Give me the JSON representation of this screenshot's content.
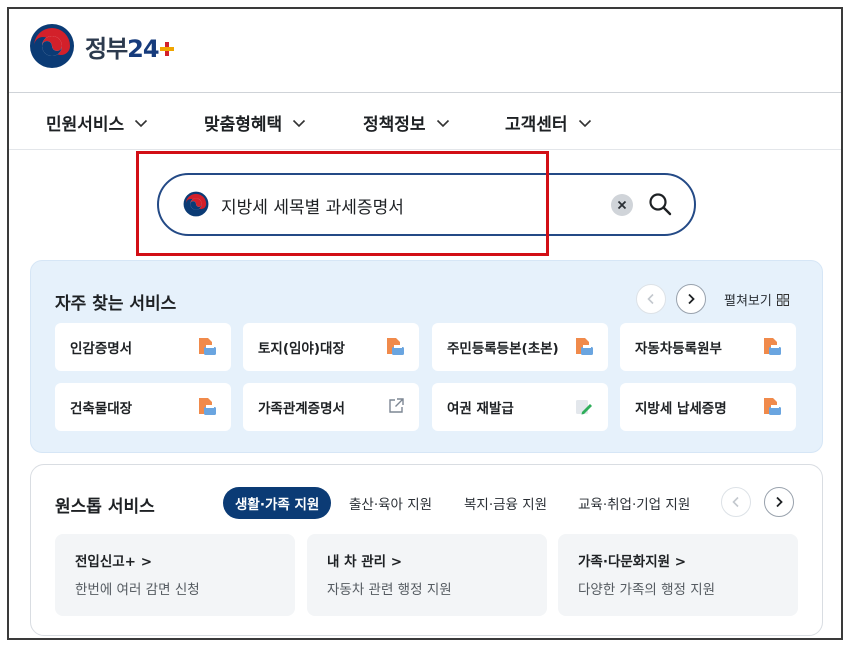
{
  "logo": {
    "text": "정부",
    "number": "24"
  },
  "nav": [
    {
      "label": "민원서비스"
    },
    {
      "label": "맞춤형혜택"
    },
    {
      "label": "정책정보"
    },
    {
      "label": "고객센터"
    }
  ],
  "search": {
    "value": "지방세 세목별 과세증명서"
  },
  "frequent": {
    "title": "자주 찾는 서비스",
    "expand_label": "펼쳐보기",
    "items": [
      {
        "label": "인감증명서",
        "icon": "document-print-icon"
      },
      {
        "label": "토지(임야)대장",
        "icon": "document-print-icon"
      },
      {
        "label": "주민등록등본(초본)",
        "icon": "document-print-icon"
      },
      {
        "label": "자동차등록원부",
        "icon": "document-print-icon"
      },
      {
        "label": "건축물대장",
        "icon": "document-print-icon"
      },
      {
        "label": "가족관계증명서",
        "icon": "external-link-icon"
      },
      {
        "label": "여권 재발급",
        "icon": "document-edit-icon"
      },
      {
        "label": "지방세 납세증명",
        "icon": "document-print-icon"
      }
    ]
  },
  "onestop": {
    "title": "원스톱 서비스",
    "tabs": [
      {
        "label": "생활·가족 지원",
        "active": true
      },
      {
        "label": "출산·육아 지원",
        "active": false
      },
      {
        "label": "복지·금융 지원",
        "active": false
      },
      {
        "label": "교육·취업·기업 지원",
        "active": false
      }
    ],
    "cards": [
      {
        "title": "전입신고+ >",
        "desc": "한번에 여러 감면 신청"
      },
      {
        "title": "내 차 관리 >",
        "desc": "자동차 관련 행정 지원"
      },
      {
        "title": "가족·다문화지원 >",
        "desc": "다양한 가족의 행정 지원"
      }
    ]
  },
  "colors": {
    "primary": "#0b3b75",
    "highlight": "#d20f15",
    "panel_bg": "#e6f1fb",
    "doc_icon": "#f08a4b"
  }
}
